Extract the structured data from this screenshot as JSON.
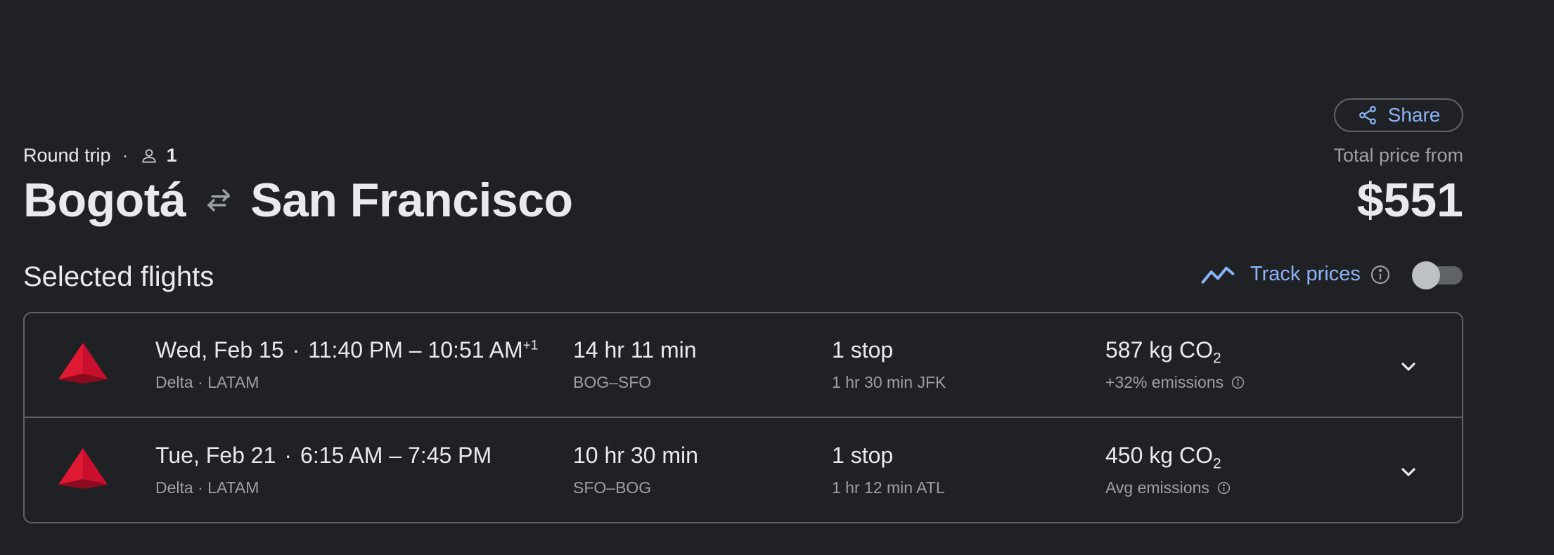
{
  "share": {
    "label": "Share",
    "icon": "share-icon"
  },
  "trip": {
    "type": "Round trip",
    "passengers": "1",
    "origin": "Bogotá",
    "destination": "San Francisco"
  },
  "price": {
    "label": "Total price from",
    "value": "$551"
  },
  "selected": {
    "title": "Selected flights",
    "track_label": "Track prices",
    "track_enabled": false
  },
  "flights": [
    {
      "date": "Wed, Feb 15",
      "depart": "11:40 PM",
      "arrive": "10:51 AM",
      "day_offset": "+1",
      "airlines": "Delta · LATAM",
      "duration": "14 hr 11 min",
      "route": "BOG–SFO",
      "stops": "1 stop",
      "layover": "1 hr 30 min JFK",
      "co2_value": "587 kg CO",
      "co2_sub": "2",
      "emissions": "+32% emissions"
    },
    {
      "date": "Tue, Feb 21",
      "depart": "6:15 AM",
      "arrive": "7:45 PM",
      "day_offset": "",
      "airlines": "Delta · LATAM",
      "duration": "10 hr 30 min",
      "route": "SFO–BOG",
      "stops": "1 stop",
      "layover": "1 hr 12 min ATL",
      "co2_value": "450 kg CO",
      "co2_sub": "2",
      "emissions": "Avg emissions"
    }
  ],
  "colors": {
    "background": "#202124",
    "accent": "#8ab4f8",
    "delta_red": "#c8102e",
    "border": "#5f6368"
  }
}
